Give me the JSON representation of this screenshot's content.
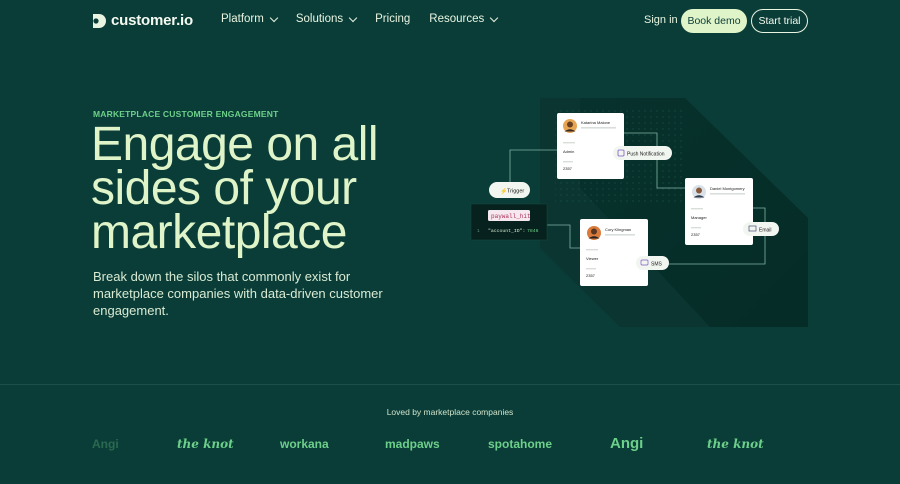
{
  "brand": {
    "name": "customer.io"
  },
  "nav": {
    "items": [
      {
        "label": "Platform",
        "dropdown": true
      },
      {
        "label": "Solutions",
        "dropdown": true
      },
      {
        "label": "Pricing",
        "dropdown": false
      },
      {
        "label": "Resources",
        "dropdown": true
      }
    ],
    "sign_in": "Sign in",
    "book_demo": "Book demo",
    "start_trial": "Start trial"
  },
  "hero": {
    "eyebrow": "MARKETPLACE CUSTOMER ENGAGEMENT",
    "headline_lines": [
      "Engage on all",
      "sides of your",
      "marketplace"
    ],
    "subtext": "Break down the silos that commonly exist for marketplace companies with data-driven customer engagement."
  },
  "illustration": {
    "trigger_label": "Trigger",
    "code_event": "paywall_hit",
    "code_line_number": "1",
    "code_key": "\"account_ID\":",
    "code_value": "7846",
    "push_label": "Push Notification",
    "email_label": "Email",
    "sms_label": "SMS",
    "cards": [
      {
        "name": "Katarina Malone",
        "role": "Admin",
        "id": "2357"
      },
      {
        "name": "Daniel Montgomery",
        "role": "Manager",
        "id": "2357"
      },
      {
        "name": "Cory Klingman",
        "role": "Viewer",
        "id": "2357"
      }
    ]
  },
  "social_proof": {
    "label": "Loved by marketplace companies",
    "brands": [
      "Angi",
      "the knot",
      "workana",
      "madpaws",
      "spotahome",
      "Angi",
      "the knot"
    ]
  },
  "colors": {
    "background": "#0b3d38",
    "accent_green": "#6dd08a",
    "headline": "#dff4c8",
    "button_fill": "#dff4c8"
  }
}
